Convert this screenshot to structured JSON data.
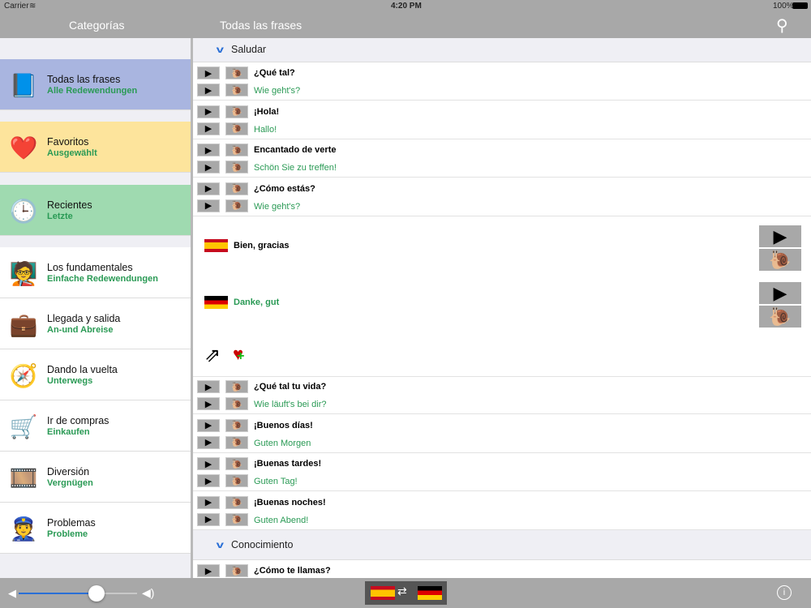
{
  "status": {
    "carrier": "Carrier",
    "time": "4:20 PM",
    "battery": "100%"
  },
  "nav": {
    "left_title": "Categorías",
    "right_title": "Todas las frases"
  },
  "categories": [
    {
      "title": "Todas las frases",
      "subtitle": "Alle Redewendungen",
      "icon": "book-icon",
      "color": "#a9b5e0"
    },
    {
      "title": "Favoritos",
      "subtitle": "Ausgewählt",
      "icon": "heart-icon",
      "color": "#fde49c"
    },
    {
      "title": "Recientes",
      "subtitle": "Letzte",
      "icon": "clock-icon",
      "color": "#9fdab0"
    },
    {
      "title": "Los fundamentales",
      "subtitle": "Einfache Redewendungen",
      "icon": "chalkboard-icon",
      "color": "#ffffff"
    },
    {
      "title": "Llegada y salida",
      "subtitle": "An-und Abreise",
      "icon": "suitcase-icon",
      "color": "#ffffff"
    },
    {
      "title": "Dando la vuelta",
      "subtitle": "Unterwegs",
      "icon": "compass-icon",
      "color": "#ffffff"
    },
    {
      "title": "Ir de compras",
      "subtitle": "Einkaufen",
      "icon": "cart-icon",
      "color": "#ffffff"
    },
    {
      "title": "Diversión",
      "subtitle": "Vergnügen",
      "icon": "film-icon",
      "color": "#ffffff"
    },
    {
      "title": "Problemas",
      "subtitle": "Probleme",
      "icon": "police-hat-icon",
      "color": "#ffffff"
    }
  ],
  "sections": [
    {
      "title": "Saludar",
      "rows": [
        {
          "es": "¿Qué tal?",
          "de": "Wie geht's?"
        },
        {
          "es": "¡Hola!",
          "de": "Hallo!"
        },
        {
          "es": "Encantado de verte",
          "de": "Schön Sie zu treffen!"
        },
        {
          "es": "¿Cómo estás?",
          "de": "Wie geht's?"
        }
      ]
    },
    {
      "title": "Conocimiento",
      "rows": [
        {
          "es": "¿Cómo te llamas?",
          "de": ""
        }
      ]
    }
  ],
  "expanded": {
    "es": "Bien, gracias",
    "de": "Danke, gut"
  },
  "rows_after": [
    {
      "es": "¿Qué tal tu vida?",
      "de": "Wie läuft's bei dir?"
    },
    {
      "es": "¡Buenos días!",
      "de": "Guten Morgen"
    },
    {
      "es": "¡Buenas tardes!",
      "de": "Guten Tag!"
    },
    {
      "es": "¡Buenas noches!",
      "de": "Guten Abend!"
    }
  ],
  "volume": 0.66
}
